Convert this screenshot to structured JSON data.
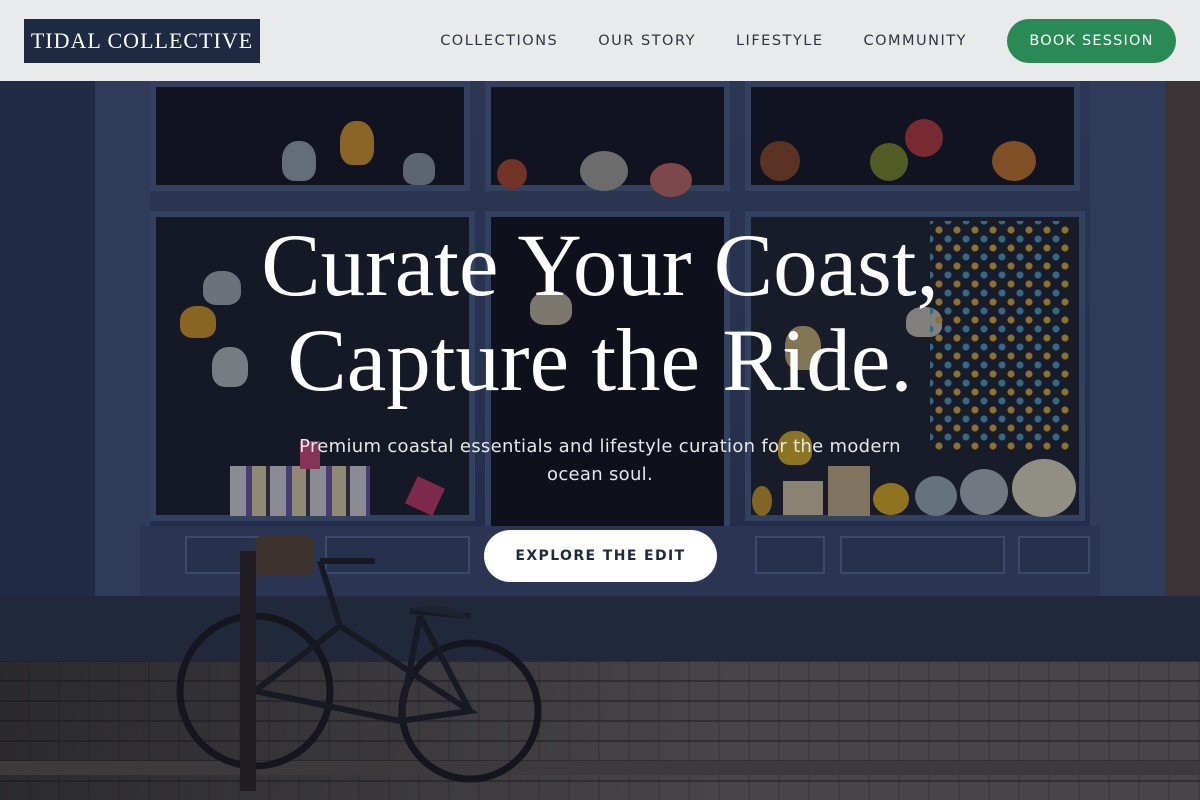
{
  "brand": {
    "name": "TIDAL COLLECTIVE"
  },
  "nav": {
    "items": [
      {
        "label": "COLLECTIONS"
      },
      {
        "label": "OUR STORY"
      },
      {
        "label": "LIFESTYLE"
      },
      {
        "label": "COMMUNITY"
      }
    ],
    "cta_label": "BOOK SESSION"
  },
  "hero": {
    "headline_line1": "Curate Your Coast,",
    "headline_line2": "Capture the Ride.",
    "subtitle": "Premium coastal essentials and lifestyle curation for the modern ocean soul.",
    "cta_label": "EXPLORE THE EDIT",
    "image_description": "shop-front-with-bicycle-photo"
  },
  "colors": {
    "header_bg": "#e9eaec",
    "logo_bg": "#1e2a42",
    "accent_green": "#2a8a55",
    "cta_bg": "#ffffff"
  }
}
